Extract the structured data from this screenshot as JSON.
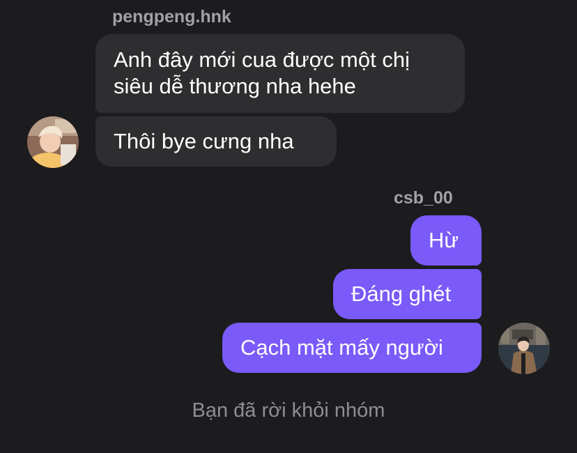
{
  "conversation": {
    "incoming": {
      "sender": "pengpeng.hnk",
      "avatar_icon": "user-avatar-pengpeng-photo",
      "messages": [
        {
          "line1": "Anh đây mới cua được một chị",
          "line2": "siêu dễ thương nha hehe"
        },
        {
          "text": "Thôi bye cưng nha"
        }
      ]
    },
    "outgoing": {
      "sender": "csb_00",
      "avatar_icon": "user-avatar-csb-photo",
      "messages": [
        {
          "text": "Hừ"
        },
        {
          "text": "Đáng ghét"
        },
        {
          "text": "Cạch mặt mấy người"
        }
      ]
    },
    "system_message": "Bạn đã rời khỏi nhóm"
  },
  "colors": {
    "background": "#1c1c1e",
    "incoming_bubble": "#2e2e30",
    "outgoing_bubble": "#7a5af8",
    "sender_name": "#a1a1a6",
    "system_text": "#8e8e93"
  }
}
